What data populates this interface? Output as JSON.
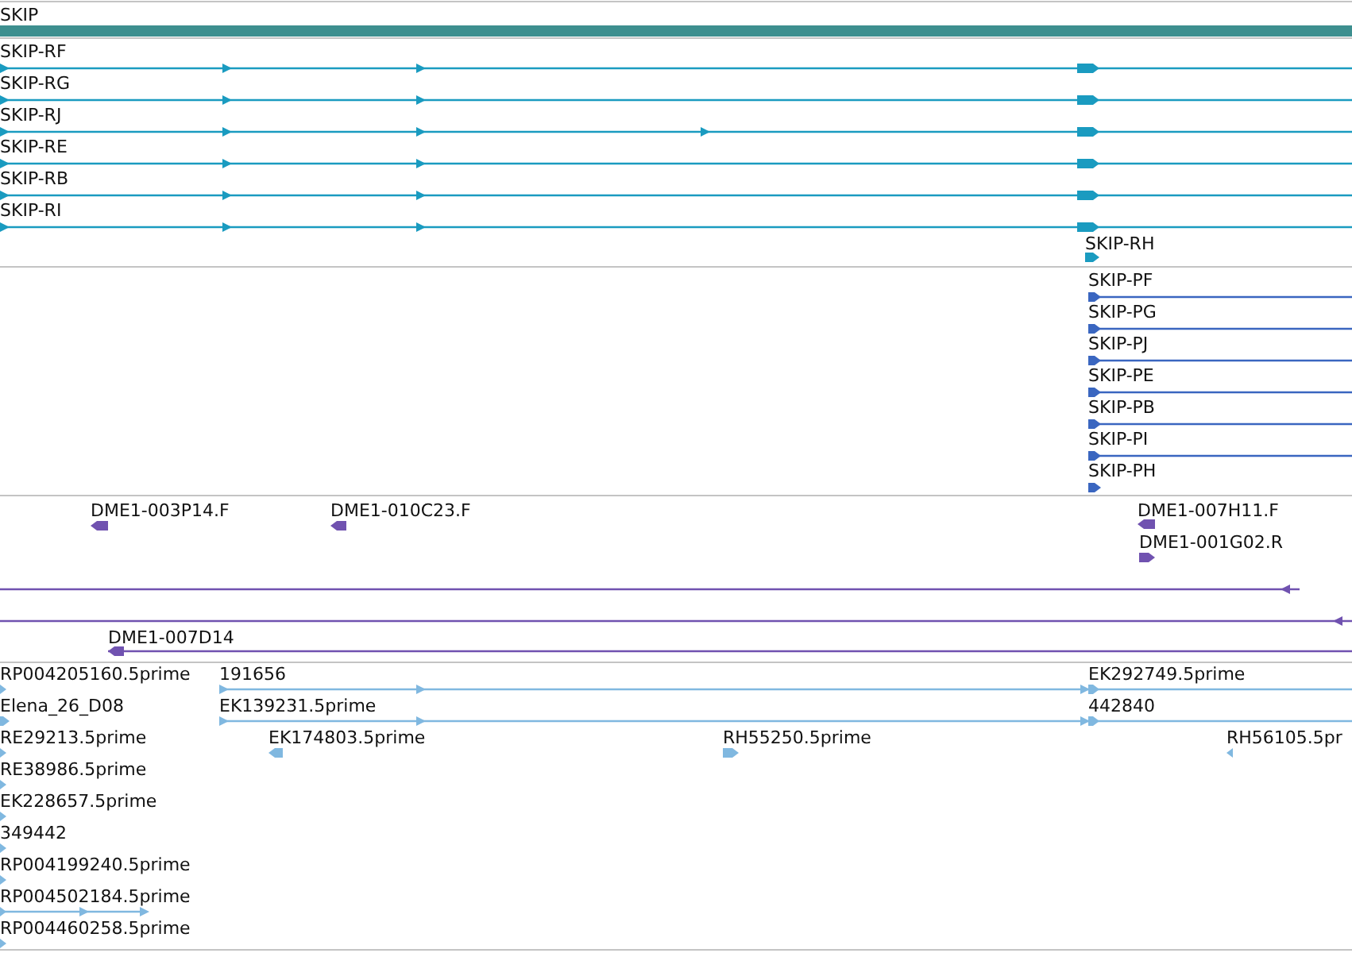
{
  "tracks": [
    {
      "kind": "gene",
      "color": "#3d8f8f",
      "features": [
        {
          "label": "SKIP"
        }
      ]
    },
    {
      "kind": "transcript",
      "color": "#1a9bc0",
      "features": [
        {
          "label": "SKIP-RF",
          "reverse": false
        },
        {
          "label": "SKIP-RG",
          "reverse": false
        },
        {
          "label": "SKIP-RJ",
          "reverse": false
        },
        {
          "label": "SKIP-RE",
          "reverse": false
        },
        {
          "label": "SKIP-RB",
          "reverse": false
        },
        {
          "label": "SKIP-RI",
          "reverse": false
        },
        {
          "label": "SKIP-RH",
          "reverse": false
        }
      ]
    },
    {
      "kind": "transcript",
      "color": "#3a66c0",
      "features": [
        {
          "label": "SKIP-PF",
          "reverse": false
        },
        {
          "label": "SKIP-PG",
          "reverse": false
        },
        {
          "label": "SKIP-PJ",
          "reverse": false
        },
        {
          "label": "SKIP-PE",
          "reverse": false
        },
        {
          "label": "SKIP-PB",
          "reverse": false
        },
        {
          "label": "SKIP-PI",
          "reverse": false
        },
        {
          "label": "SKIP-PH",
          "reverse": false
        }
      ]
    },
    {
      "kind": "clone",
      "color": "#7052b0",
      "features": [
        {
          "label": "DME1-003P14.F",
          "reverse": true
        },
        {
          "label": "DME1-010C23.F",
          "reverse": true
        },
        {
          "label": "DME1-007H11.F",
          "reverse": true
        },
        {
          "label": "DME1-001G02.R",
          "reverse": false
        },
        {
          "reverse": true
        },
        {
          "reverse": true
        },
        {
          "label": "DME1-007D14",
          "reverse": true
        }
      ]
    },
    {
      "kind": "est",
      "color": "#80b8e0",
      "features": [
        {
          "label": "RP004205160.5prime",
          "reverse": false
        },
        {
          "label": "191656",
          "reverse": false
        },
        {
          "label": "EK292749.5prime",
          "reverse": false
        },
        {
          "label": "Elena_26_D08",
          "reverse": false
        },
        {
          "label": "EK139231.5prime",
          "reverse": false
        },
        {
          "label": "442840",
          "reverse": false
        },
        {
          "label": "RE29213.5prime",
          "reverse": false
        },
        {
          "label": "EK174803.5prime",
          "reverse": true
        },
        {
          "label": "RH55250.5prime",
          "reverse": false
        },
        {
          "label": "RH56105.5pr",
          "reverse": true
        },
        {
          "label": "RE38986.5prime",
          "reverse": false
        },
        {
          "label": "EK228657.5prime",
          "reverse": false
        },
        {
          "label": "349442",
          "reverse": false
        },
        {
          "label": "RP004199240.5prime",
          "reverse": false
        },
        {
          "label": "RP004502184.5prime",
          "reverse": false
        },
        {
          "label": "RP004460258.5prime",
          "reverse": false
        }
      ]
    }
  ]
}
